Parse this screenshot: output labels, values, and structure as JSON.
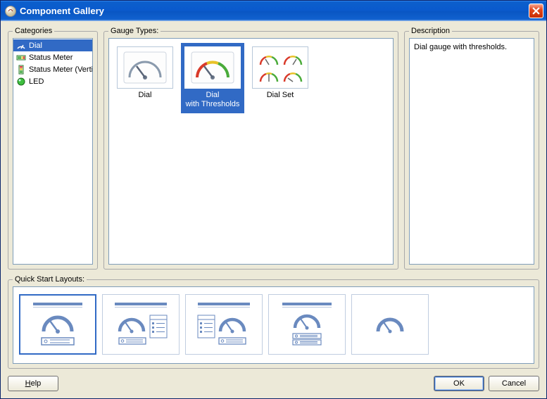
{
  "title": "Component Gallery",
  "sections": {
    "categories_label": "Categories",
    "gauge_types_label": "Gauge Types:",
    "description_label": "Description",
    "quick_start_label": "Quick Start Layouts:"
  },
  "categories": {
    "items": [
      {
        "label": "Dial",
        "selected": true
      },
      {
        "label": "Status Meter",
        "selected": false
      },
      {
        "label": "Status Meter (Verti...",
        "selected": false
      },
      {
        "label": "LED",
        "selected": false
      }
    ]
  },
  "gauge_types": {
    "items": [
      {
        "label": "Dial",
        "selected": false
      },
      {
        "label": "Dial\nwith Thresholds",
        "selected": true
      },
      {
        "label": "Dial Set",
        "selected": false
      }
    ]
  },
  "description": {
    "text": "Dial gauge with thresholds."
  },
  "quick_start": {
    "selected_index": 0,
    "count": 5
  },
  "buttons": {
    "help": "Help",
    "ok": "OK",
    "cancel": "Cancel"
  }
}
